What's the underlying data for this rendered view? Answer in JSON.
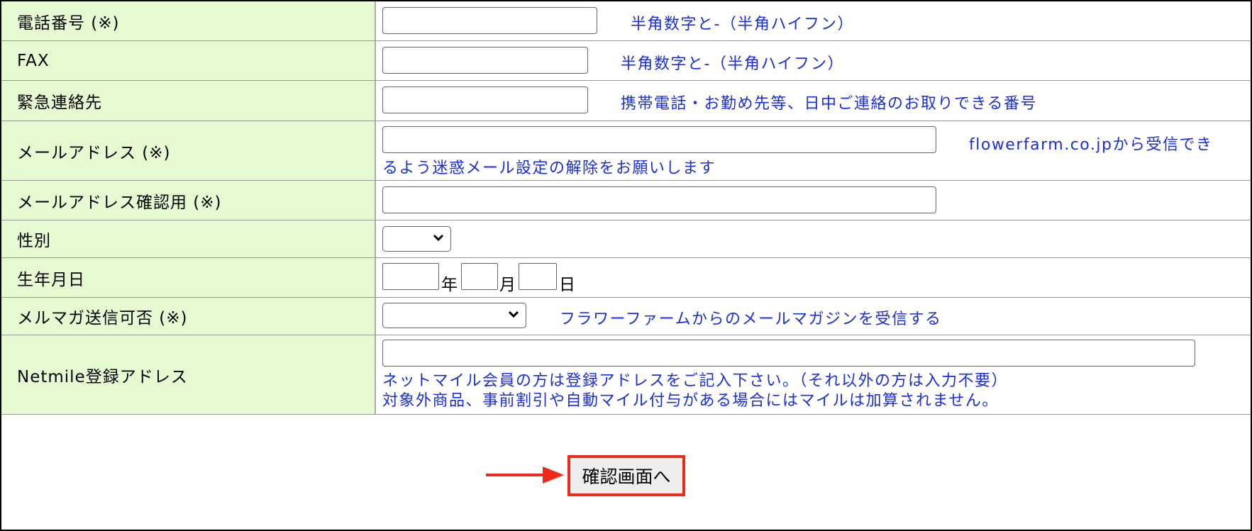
{
  "form": {
    "phone": {
      "label": "電話番号 (※)",
      "hint": "半角数字と-（半角ハイフン）"
    },
    "fax": {
      "label": "FAX",
      "hint": "半角数字と-（半角ハイフン）"
    },
    "emergency": {
      "label": "緊急連絡先",
      "hint": "携帯電話・お勤め先等、日中ご連絡のお取りできる番号"
    },
    "email": {
      "label": "メールアドレス (※)",
      "hint_line1": "flowerfarm.co.jpから受信でき",
      "hint_line2": "るよう迷惑メール設定の解除をお願いします"
    },
    "email_confirm": {
      "label": "メールアドレス確認用 (※)"
    },
    "gender": {
      "label": "性別",
      "selected": ""
    },
    "birthday": {
      "label": "生年月日",
      "year_unit": "年",
      "month_unit": "月",
      "day_unit": "日"
    },
    "newsletter": {
      "label": "メルマガ送信可否 (※)",
      "selected": "",
      "hint": "フラワーファームからのメールマガジンを受信する"
    },
    "netmile": {
      "label": "Netmile登録アドレス",
      "hint_line1": "ネットマイル会員の方は登録アドレスをご記入下さい。（それ以外の方は入力不要）",
      "hint_line2": "対象外商品、事前割引や自動マイル付与がある場合にはマイルは加算されません。"
    }
  },
  "submit": {
    "label": "確認画面へ"
  },
  "colors": {
    "label_bg": "#e6fad2",
    "hint_text": "#1a2fd4",
    "highlight": "#ee2a18"
  }
}
